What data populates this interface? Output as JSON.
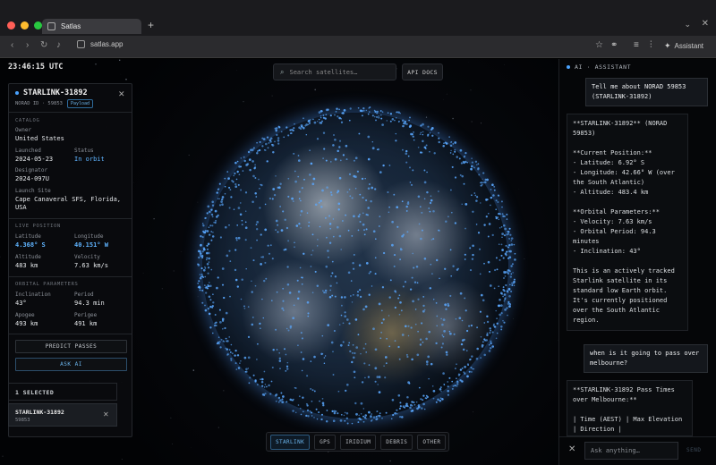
{
  "browser": {
    "tab_title": "Satlas",
    "new_tab": "+",
    "tab_menu": "⌄",
    "window_close": "✕",
    "url": "satlas.app",
    "assistant_label": "Assistant",
    "light_colors": [
      "#ff5f57",
      "#febc2e",
      "#28c840"
    ]
  },
  "app": {
    "clock": "23:46:15 UTC",
    "search_placeholder": "Search satellites…",
    "api_docs": "API DOCS"
  },
  "detail": {
    "name": "STARLINK-31892",
    "norad_label": "NORAD ID · 59853",
    "type_badge": "Payload",
    "catalog_title": "CATALOG",
    "owner_label": "Owner",
    "owner": "United States",
    "launched_label": "Launched",
    "launched": "2024-05-23",
    "status_label": "Status",
    "status": "In orbit",
    "designator_label": "Designator",
    "designator": "2024-097U",
    "site_label": "Launch Site",
    "site_line1": "Cape Canaveral SFS, Florida,",
    "site_line2": "USA",
    "live_title": "LIVE POSITION",
    "lat_label": "Latitude",
    "lat": "4.368° S",
    "lon_label": "Longitude",
    "lon": "40.151° W",
    "alt_label": "Altitude",
    "alt": "483 km",
    "vel_label": "Velocity",
    "vel": "7.63 km/s",
    "orbit_title": "ORBITAL PARAMETERS",
    "inc_label": "Inclination",
    "inc": "43°",
    "period_label": "Period",
    "period": "94.3 min",
    "apogee_label": "Apogee",
    "apogee": "493 km",
    "perigee_label": "Perigee",
    "perigee": "491 km",
    "predict_btn": "PREDICT PASSES",
    "ask_btn": "ASK AI"
  },
  "selected": {
    "header": "1 SELECTED",
    "item_name": "STARLINK-31892",
    "item_id": "59853"
  },
  "filters": [
    "STARLINK",
    "GPS",
    "IRIDIUM",
    "DEBRIS",
    "OTHER"
  ],
  "chat": {
    "header": "AI · ASSISTANT",
    "user_msg_1": "Tell me about NORAD 59853\n(STARLINK-31892)",
    "ai_msg_1": "**STARLINK-31892** (NORAD\n59853)\n\n**Current Position:**\n- Latitude: 6.92° S\n- Longitude: 42.66° W (over\nthe South Atlantic)\n- Altitude: 483.4 km\n\n**Orbital Parameters:**\n- Velocity: 7.63 km/s\n- Orbital Period: 94.3\nminutes\n- Inclination: 43°\n\nThis is an actively tracked\nStarlink satellite in its\nstandard low Earth orbit.\nIt's currently positioned\nover the South Atlantic\nregion.",
    "user_msg_2": "when is it going to pass over\nmelbourne?",
    "ai_msg_2": "**STARLINK-31892 Pass Times\nover Melbourne:**\n\n| Time (AEST) | Max Elevation\n| Direction |",
    "input_placeholder": "Ask anything…",
    "send": "SEND"
  },
  "colors": {
    "accent": "#4aa3ff",
    "orbit_glow": "#5aa8ff"
  }
}
